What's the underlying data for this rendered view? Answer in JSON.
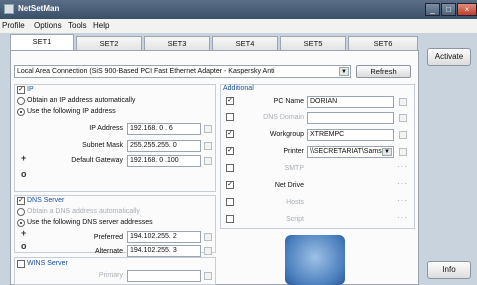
{
  "window": {
    "title": "NetSetMan",
    "min": "_",
    "max": "□",
    "close": "×"
  },
  "menu": [
    "Profile",
    "Options",
    "Tools",
    "Help"
  ],
  "tabs": [
    "SET1",
    "SET2",
    "SET3",
    "SET4",
    "SET5",
    "SET6"
  ],
  "side": {
    "activate": "Activate",
    "info": "Info"
  },
  "adapter": {
    "value": "Local Area Connection (SiS 900-Based PCI Fast Ethernet Adapter - Kaspersky Anti",
    "refresh": "Refresh"
  },
  "ip": {
    "title": "IP",
    "auto": "Obtain an IP address automatically",
    "manual": "Use the following IP address",
    "address_label": "IP Address",
    "address": "192.168. 0 . 6",
    "mask_label": "Subnet Mask",
    "mask": "255.255.255. 0",
    "gw_label": "Default Gateway",
    "gw": "192.168. 0 .100"
  },
  "dns": {
    "title": "DNS Server",
    "auto": "Obtain a DNS address automatically",
    "manual": "Use the following DNS server addresses",
    "preferred_label": "Preferred",
    "preferred": "194.102.255. 2",
    "alternate_label": "Alternate",
    "alternate": "194.102.255. 3"
  },
  "wins": {
    "title": "WINS Server",
    "primary_label": "Primary"
  },
  "additional": {
    "title": "Additional",
    "pcname_label": "PC Name",
    "pcname": "DORIAN",
    "dnsdomain_label": "DNS Domain",
    "workgroup_label": "Workgroup",
    "workgroup": "XTREMPC",
    "printer_label": "Printer",
    "printer": "\\\\SECRETARIAT\\Sams",
    "smtp_label": "SMTP",
    "netdrive_label": "Net Drive",
    "hosts_label": "Hosts",
    "script_label": "Script"
  },
  "colors": {
    "titlebar": "#3a4f68",
    "accent": "#1a4fa8"
  }
}
